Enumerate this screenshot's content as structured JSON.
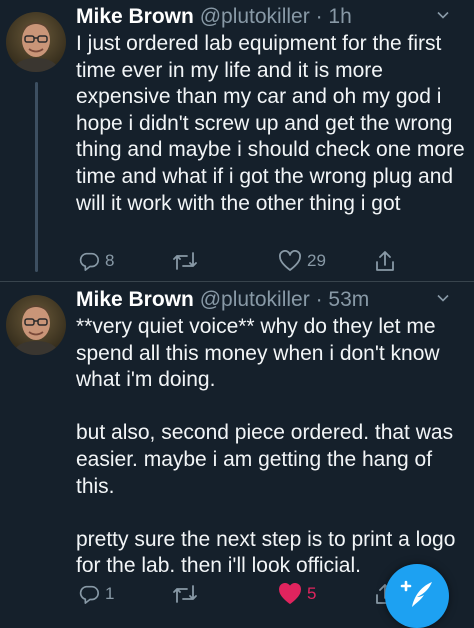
{
  "tweets": [
    {
      "author_name": "Mike Brown",
      "handle": "@plutokiller",
      "time": "· 1h",
      "text": "I just ordered lab equipment for the first time ever in my life and it is more expensive than my car and oh my god i hope i didn't screw up and get the wrong thing and maybe i should check one more time and what if i got the wrong plug and will it work with the other thing i got",
      "reply_count": "8",
      "retweet_count": "",
      "like_count": "29",
      "liked": false
    },
    {
      "author_name": "Mike Brown",
      "handle": "@plutokiller",
      "time": "· 53m",
      "text": "**very quiet voice** why do they let me spend all this money when i don't know what i'm doing.\n\nbut also, second piece ordered. that was easier. maybe i am getting the hang of this.\n\npretty sure the next step is to print a logo for the lab. then i'll look official.",
      "reply_count": "1",
      "retweet_count": "",
      "like_count": "5",
      "liked": true
    }
  ],
  "icons": {
    "reply": "reply-icon",
    "retweet": "retweet-icon",
    "like": "heart-icon",
    "share": "share-icon",
    "more": "chevron-down-icon",
    "compose": "compose-tweet-icon"
  },
  "colors": {
    "background": "#15202b",
    "secondary_text": "#8899a6",
    "like_active": "#e0245e",
    "accent": "#1da1f2"
  }
}
